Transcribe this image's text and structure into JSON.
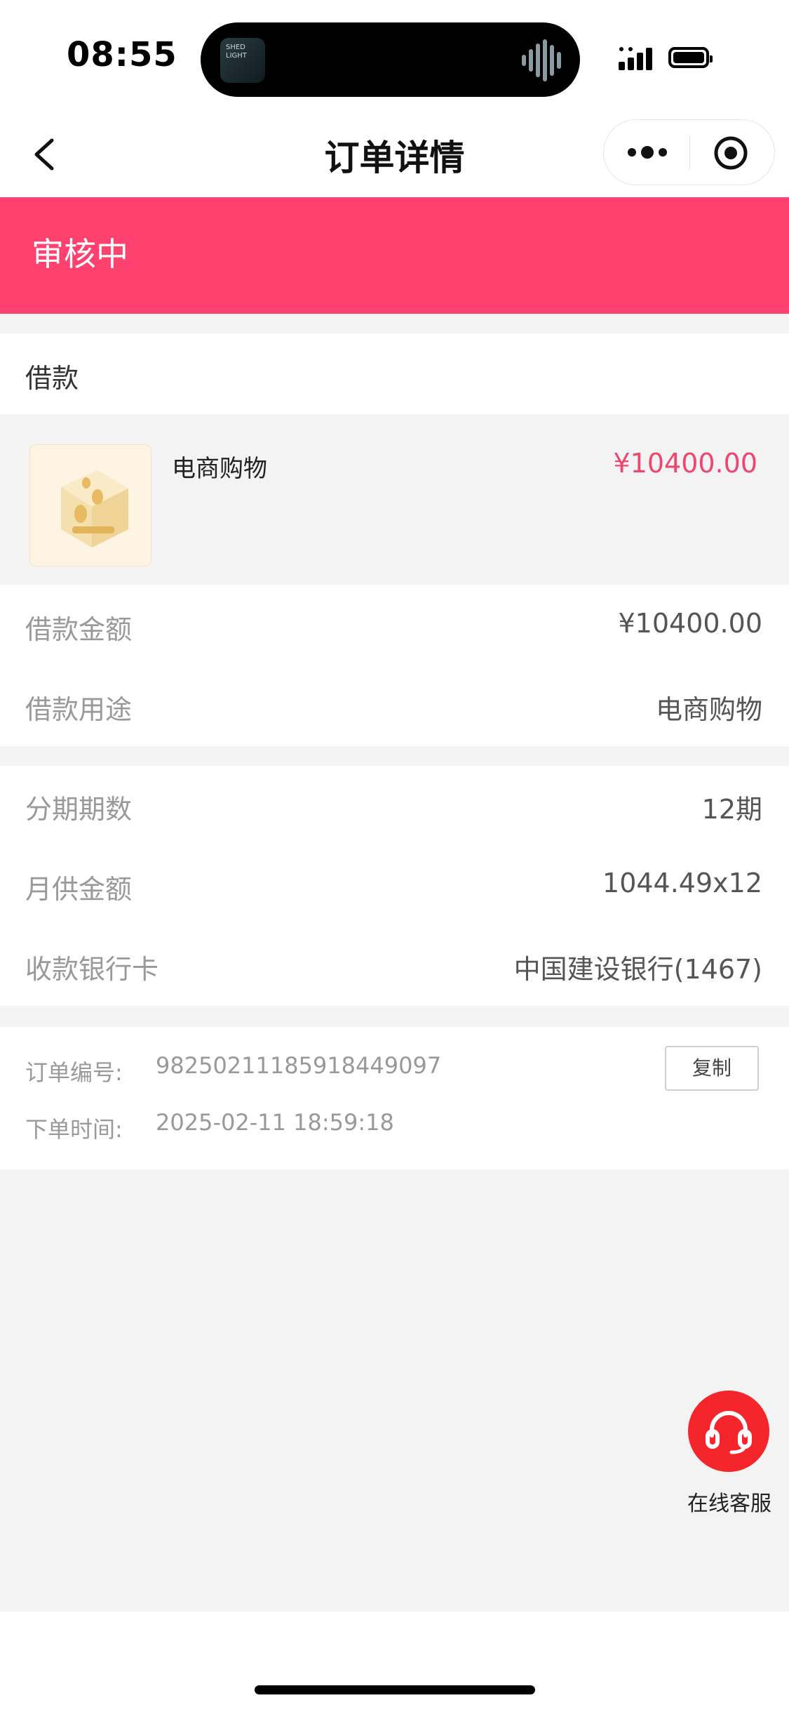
{
  "status_bar": {
    "time": "08:55",
    "island_thumb_text": "SHED LIGHT"
  },
  "nav": {
    "title": "订单详情"
  },
  "order_status": "审核中",
  "section": {
    "title": "借款"
  },
  "product": {
    "name": "电商购物",
    "price": "¥10400.00"
  },
  "loan_rows": [
    {
      "label": "借款金额",
      "value": "¥10400.00"
    },
    {
      "label": "借款用途",
      "value": "电商购物"
    }
  ],
  "plan_rows": [
    {
      "label": "分期期数",
      "value": "12期"
    },
    {
      "label": "月供金额",
      "value": "1044.49x12"
    },
    {
      "label": "收款银行卡",
      "value": "中国建设银行(1467)"
    }
  ],
  "order_info": {
    "number_label": "订单编号:",
    "number": "98250211185918449097",
    "time_label": "下单时间:",
    "time": "2025-02-11 18:59:18",
    "copy_label": "复制"
  },
  "customer_service": {
    "label": "在线客服"
  },
  "colors": {
    "accent": "#ff416f",
    "price": "#f0456e",
    "service": "#f5262b"
  }
}
